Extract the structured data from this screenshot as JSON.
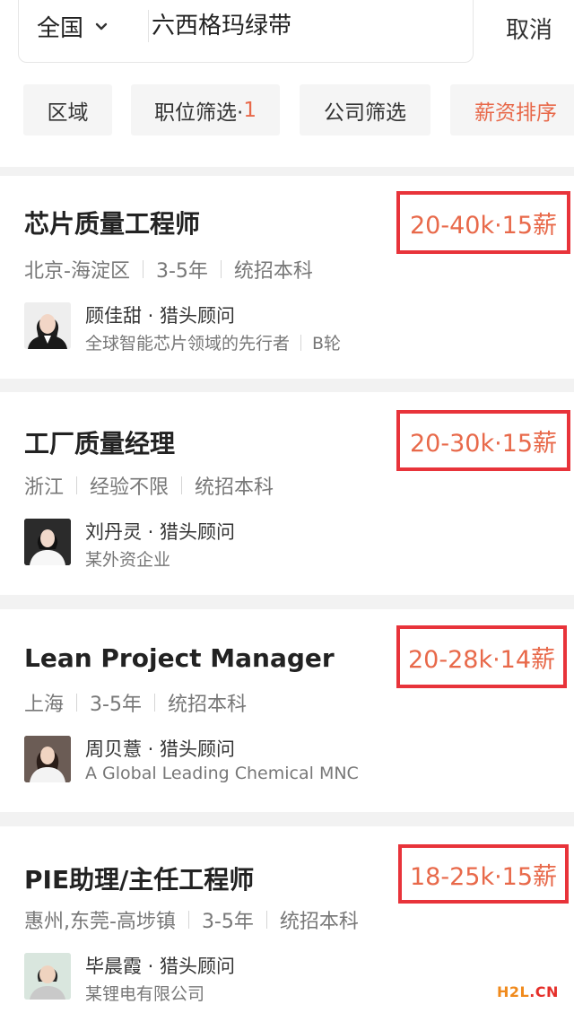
{
  "search": {
    "region": "全国",
    "query": "六西格玛绿带",
    "cancel_label": "取消"
  },
  "filters": {
    "area": "区域",
    "position_label": "职位筛选·",
    "position_count": "1",
    "company": "公司筛选",
    "sort": "薪资排序"
  },
  "jobs": [
    {
      "title": "芯片质量工程师",
      "salary": "20-40k·15薪",
      "location": "北京-海淀区",
      "experience": "3-5年",
      "education": "统招本科",
      "consultant": "顾佳甜 · 猎头顾问",
      "company": "全球智能芯片领域的先行者",
      "company_stage": "B轮"
    },
    {
      "title": "工厂质量经理",
      "salary": "20-30k·15薪",
      "location": "浙江",
      "experience": "经验不限",
      "education": "统招本科",
      "consultant": "刘丹灵 · 猎头顾问",
      "company": "某外资企业"
    },
    {
      "title": "Lean Project Manager",
      "salary": "20-28k·14薪",
      "location": "上海",
      "experience": "3-5年",
      "education": "统招本科",
      "consultant": "周贝薏 · 猎头顾问",
      "company": "A Global Leading Chemical MNC"
    },
    {
      "title": "PIE助理/主任工程师",
      "salary": "18-25k·15薪",
      "location": "惠州,东莞-高埗镇",
      "experience": "3-5年",
      "education": "统招本科",
      "consultant": "毕晨霞 · 猎头顾问",
      "company": "某锂电有限公司"
    }
  ],
  "watermark": {
    "part1": "H2L",
    "part2": ".CN"
  },
  "colors": {
    "accent": "#e8694a",
    "highlight_border": "#e8333a",
    "watermark_orange": "#f08a1c",
    "watermark_red": "#e52f2a"
  }
}
